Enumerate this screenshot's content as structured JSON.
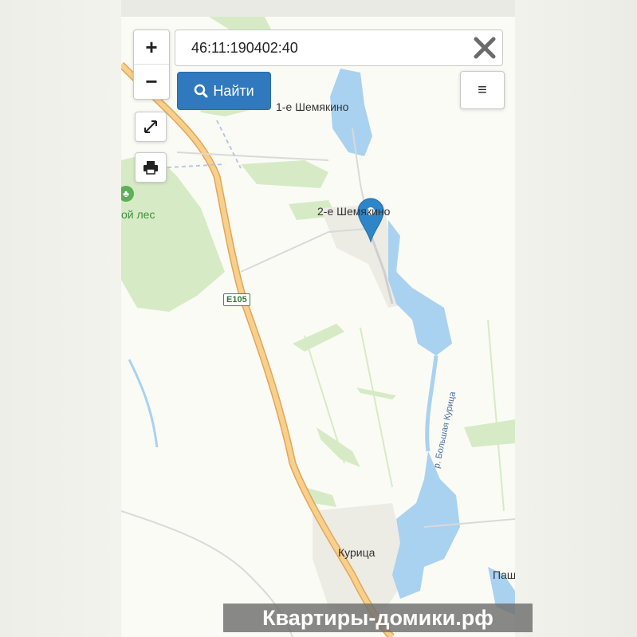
{
  "search": {
    "value": "46:11:190402:40"
  },
  "controls": {
    "zoom_in": "+",
    "zoom_out": "−",
    "find_label": "Найти",
    "menu_glyph": "≡"
  },
  "map": {
    "places": {
      "shemyakino1": "1-е Шемякино",
      "shemyakino2": "2-е Шемякино",
      "kuritsa": "Курица",
      "pash": "Паш",
      "forest": "ой лес"
    },
    "road_shield": "E105",
    "river": "р. Большая Курица"
  },
  "watermark": "Квартиры-домики.рф",
  "icons": [
    "plus-icon",
    "minus-icon",
    "fullscreen-icon",
    "print-icon",
    "search-icon",
    "close-icon",
    "menu-icon",
    "map-marker-icon",
    "forest-icon"
  ],
  "colors": {
    "accent": "#3079be",
    "marker": "#2e86c9",
    "water": "#a9d2f0",
    "road": "#f4c27a",
    "forest": "#d6ebc5"
  }
}
